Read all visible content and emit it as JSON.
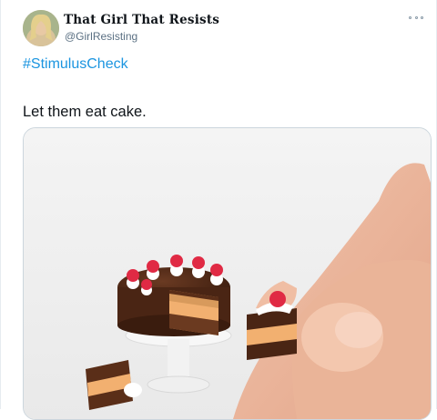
{
  "author": {
    "display_name": "That Girl That Resists",
    "handle": "@GirlResisting",
    "avatar_icon": "profile-photo"
  },
  "menu": {
    "icon": "more-options-icon"
  },
  "tweet": {
    "hashtag": "#StimulusCheck",
    "text": "Let them eat cake."
  },
  "media": {
    "icon": "photo-miniature-cake",
    "colors": {
      "link": "#1b95e0",
      "border": "#ccd6dd",
      "muted": "#5b7083"
    }
  }
}
